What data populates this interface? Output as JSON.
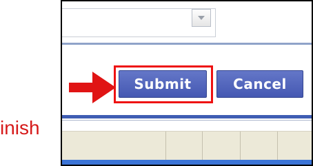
{
  "form": {
    "submit_label": "Submit",
    "cancel_label": "Cancel"
  },
  "annotation": {
    "label": "inish",
    "color": "#d61a1a"
  },
  "icons": {
    "dropdown": "chevron-down-icon",
    "pointer": "red-arrow-icon"
  },
  "colors": {
    "button": "#5062bd",
    "highlight": "#ee1111",
    "accent_bar": "#3f5db3",
    "taskbar": "#3b74d6"
  }
}
